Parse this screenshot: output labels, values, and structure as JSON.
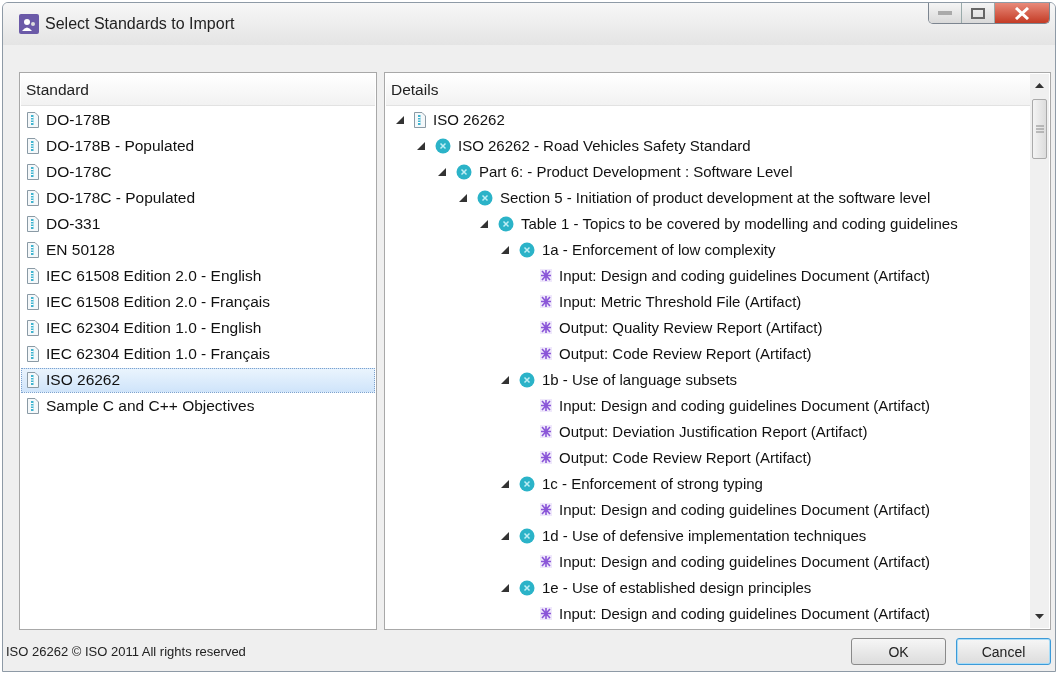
{
  "window": {
    "title": "Select Standards to Import"
  },
  "standards": {
    "heading": "Standard",
    "items": [
      {
        "label": "DO-178B",
        "selected": false
      },
      {
        "label": "DO-178B - Populated",
        "selected": false
      },
      {
        "label": "DO-178C",
        "selected": false
      },
      {
        "label": "DO-178C - Populated",
        "selected": false
      },
      {
        "label": "DO-331",
        "selected": false
      },
      {
        "label": "EN 50128",
        "selected": false
      },
      {
        "label": "IEC 61508 Edition 2.0 - English",
        "selected": false
      },
      {
        "label": "IEC 61508 Edition 2.0 - Français",
        "selected": false
      },
      {
        "label": "IEC 62304 Edition 1.0 - English",
        "selected": false
      },
      {
        "label": "IEC 62304 Edition 1.0 - Français",
        "selected": false
      },
      {
        "label": "ISO 26262",
        "selected": true
      },
      {
        "label": "Sample C and C++ Objectives",
        "selected": false
      }
    ]
  },
  "details": {
    "heading": "Details",
    "tree": [
      {
        "kind": "standard",
        "label": "ISO 26262",
        "expanded": true,
        "children": [
          {
            "kind": "node",
            "label": "ISO 26262 - Road Vehicles Safety Standard",
            "expanded": true,
            "children": [
              {
                "kind": "node",
                "label": "Part 6: - Product Development : Software Level",
                "expanded": true,
                "children": [
                  {
                    "kind": "node",
                    "label": "Section 5 - Initiation of product development at the software level",
                    "expanded": true,
                    "children": [
                      {
                        "kind": "node",
                        "label": "Table 1 - Topics to be covered by modelling and coding guidelines",
                        "expanded": true,
                        "children": [
                          {
                            "kind": "node",
                            "label": "1a - Enforcement of low complexity",
                            "expanded": true,
                            "children": [
                              {
                                "kind": "artifact",
                                "label": "Input: Design and coding guidelines Document (Artifact)"
                              },
                              {
                                "kind": "artifact",
                                "label": "Input: Metric Threshold File (Artifact)"
                              },
                              {
                                "kind": "artifact",
                                "label": "Output: Quality Review Report (Artifact)"
                              },
                              {
                                "kind": "artifact",
                                "label": "Output: Code Review Report (Artifact)"
                              }
                            ]
                          },
                          {
                            "kind": "node",
                            "label": "1b - Use of language subsets",
                            "expanded": true,
                            "children": [
                              {
                                "kind": "artifact",
                                "label": "Input: Design and coding guidelines Document (Artifact)"
                              },
                              {
                                "kind": "artifact",
                                "label": "Output: Deviation Justification Report (Artifact)"
                              },
                              {
                                "kind": "artifact",
                                "label": "Output: Code Review Report (Artifact)"
                              }
                            ]
                          },
                          {
                            "kind": "node",
                            "label": "1c - Enforcement of strong typing",
                            "expanded": true,
                            "children": [
                              {
                                "kind": "artifact",
                                "label": "Input: Design and coding guidelines Document (Artifact)"
                              }
                            ]
                          },
                          {
                            "kind": "node",
                            "label": "1d - Use of defensive implementation techniques",
                            "expanded": true,
                            "children": [
                              {
                                "kind": "artifact",
                                "label": "Input: Design and coding guidelines Document (Artifact)"
                              }
                            ]
                          },
                          {
                            "kind": "node",
                            "label": "1e - Use of established design principles",
                            "expanded": true,
                            "children": [
                              {
                                "kind": "artifact",
                                "label": "Input: Design and coding guidelines Document (Artifact)"
                              }
                            ]
                          }
                        ]
                      }
                    ]
                  }
                ]
              }
            ]
          }
        ]
      }
    ]
  },
  "copyright": "ISO 26262  © ISO 2011  All rights reserved",
  "buttons": [
    {
      "label": "OK",
      "default": false
    },
    {
      "label": "Cancel",
      "default": true
    }
  ]
}
